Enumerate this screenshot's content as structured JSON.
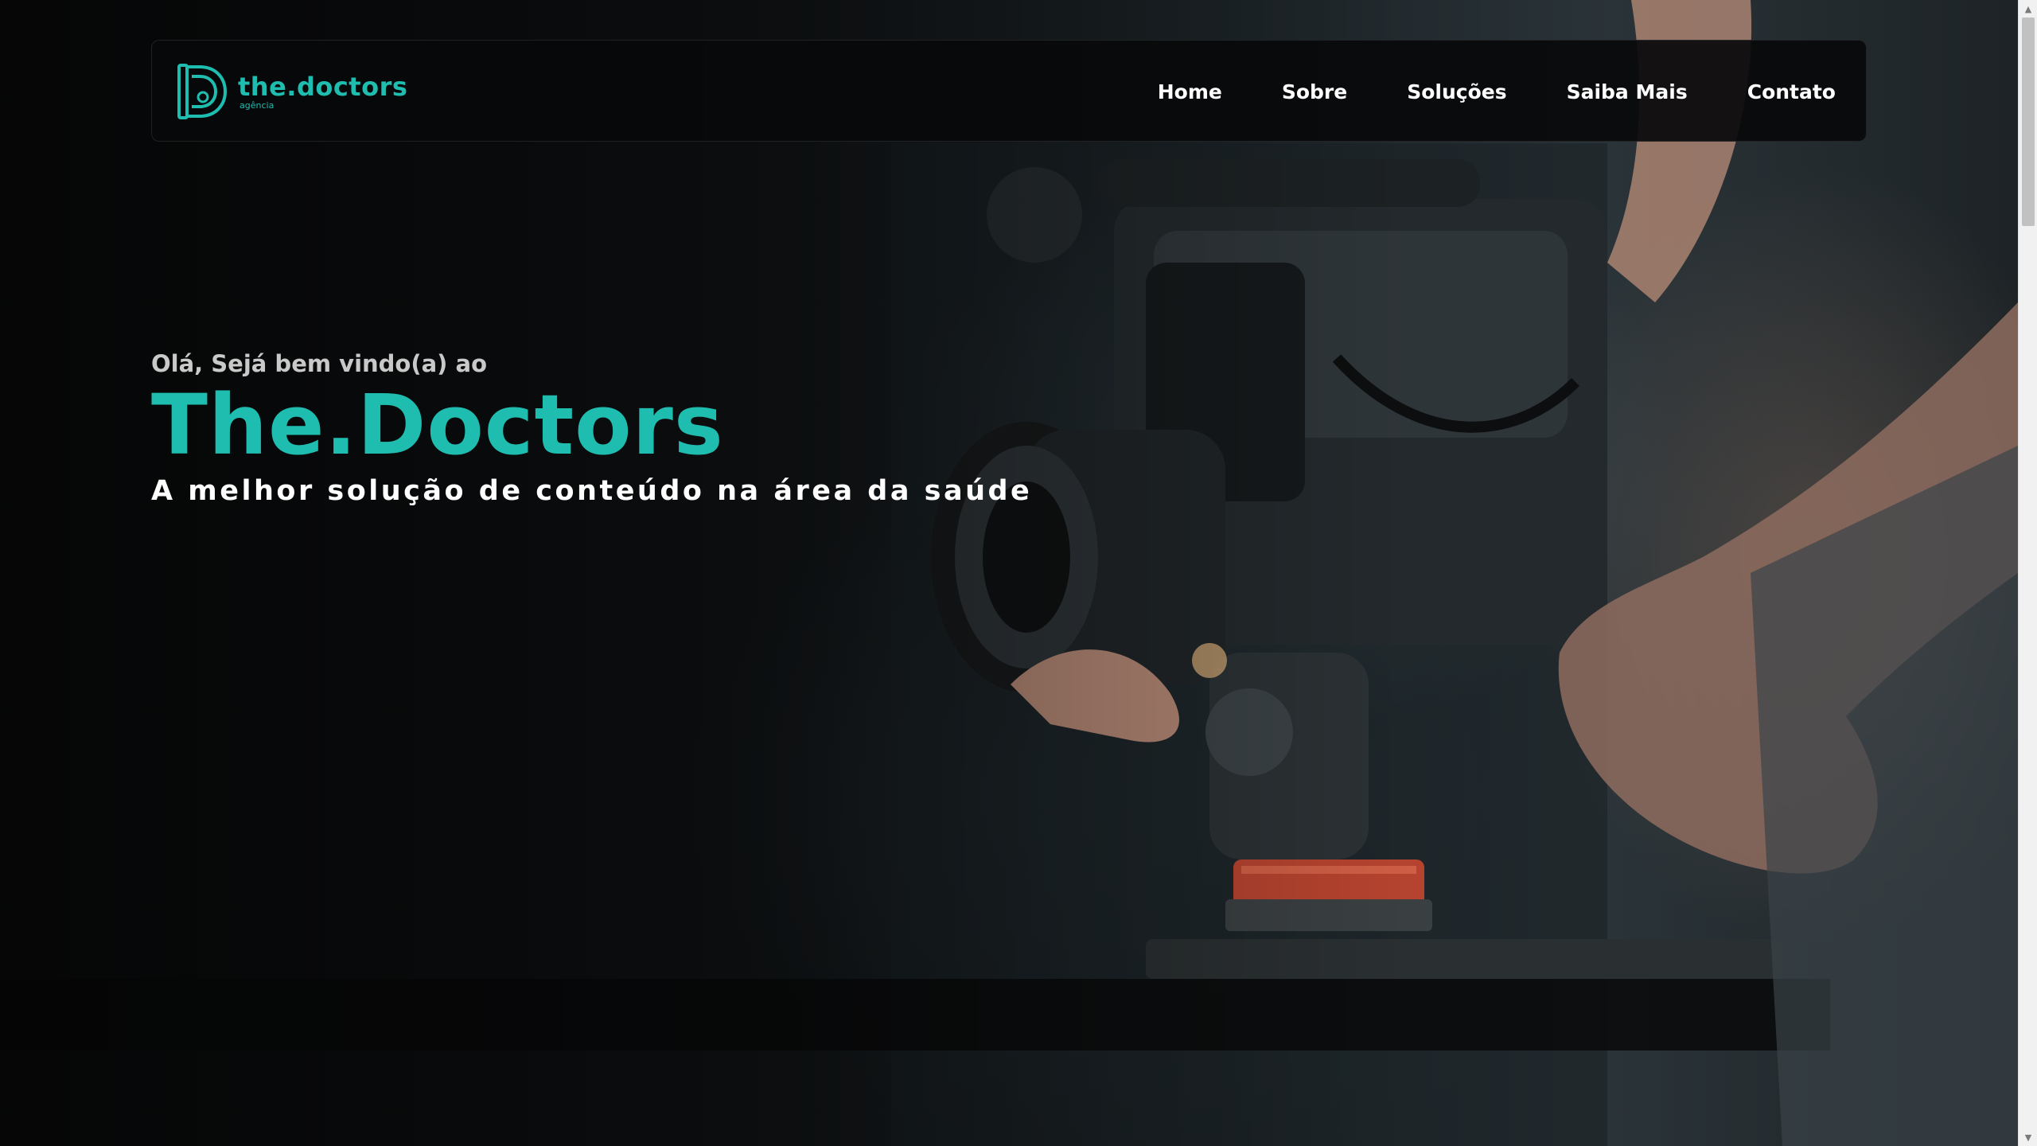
{
  "logo": {
    "name": "the.doctors",
    "subtitle": "agência"
  },
  "nav": {
    "items": [
      {
        "label": "Home"
      },
      {
        "label": "Sobre"
      },
      {
        "label": "Soluções"
      },
      {
        "label": "Saiba Mais"
      },
      {
        "label": "Contato"
      }
    ]
  },
  "hero": {
    "greeting": "Olá, Sejá bem vindo(a) ao",
    "title": "The.Doctors",
    "tagline": "A melhor solução de conteúdo na área da saúde",
    "background_image": "camera-operator-photo"
  },
  "colors": {
    "brand": "#1fbdb0",
    "text_light": "#ffffff",
    "text_muted": "#c9c9c9",
    "nav_bg": "#08090a"
  },
  "scrollbar": {
    "up_icon": "arrow-up-icon",
    "down_icon": "arrow-down-icon"
  }
}
